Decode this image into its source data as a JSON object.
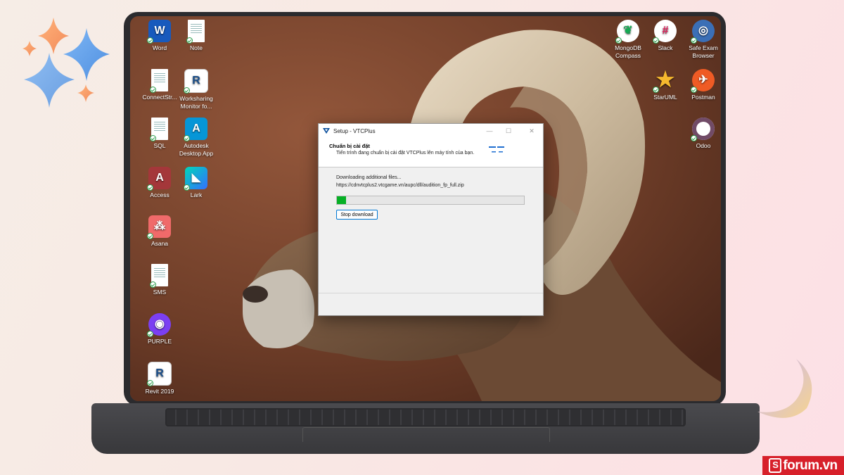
{
  "desktop": {
    "left_icons": [
      {
        "label": "Word",
        "icon": "word-icon",
        "color": "#185abd",
        "glyph": "W"
      },
      {
        "label": "Note",
        "icon": "note-icon",
        "color": "#ffffff",
        "glyph": ""
      },
      {
        "label": "ConnectStr...",
        "icon": "text-file-icon",
        "color": "#ffffff",
        "glyph": ""
      },
      {
        "label": "Worksharing Monitor fo...",
        "icon": "revit-worksharing-icon",
        "color": "#ffffff",
        "glyph": "R"
      },
      {
        "label": "SQL",
        "icon": "text-file-icon",
        "color": "#ffffff",
        "glyph": ""
      },
      {
        "label": "Autodesk Desktop App",
        "icon": "autodesk-icon",
        "color": "#0696d7",
        "glyph": "A"
      },
      {
        "label": "Access",
        "icon": "access-icon",
        "color": "#a4373a",
        "glyph": "A"
      },
      {
        "label": "Lark",
        "icon": "lark-icon",
        "color": "#3370ff",
        "glyph": ""
      },
      {
        "label": "Asana",
        "icon": "asana-icon",
        "color": "#f06a6a",
        "glyph": ""
      },
      {
        "label": "SMS",
        "icon": "text-file-icon",
        "color": "#ffffff",
        "glyph": ""
      },
      {
        "label": "PURPLE",
        "icon": "purple-icon",
        "color": "#7b3ff2",
        "glyph": ""
      },
      {
        "label": "Revit 2019",
        "icon": "revit-icon",
        "color": "#ffffff",
        "glyph": "R"
      }
    ],
    "right_icons": [
      {
        "label": "MongoDB Compass",
        "icon": "mongodb-compass-icon",
        "color": "#ffffff",
        "glyph": ""
      },
      {
        "label": "Slack",
        "icon": "slack-icon",
        "color": "#ffffff",
        "glyph": ""
      },
      {
        "label": "Safe Exam Browser",
        "icon": "safe-exam-browser-icon",
        "color": "#3b6fb6",
        "glyph": ""
      },
      {
        "label": "StarUML",
        "icon": "staruml-icon",
        "color": "transparent",
        "glyph": ""
      },
      {
        "label": "Postman",
        "icon": "postman-icon",
        "color": "#ef5b25",
        "glyph": ""
      },
      {
        "label": "Odoo",
        "icon": "odoo-icon",
        "color": "#714b67",
        "glyph": ""
      }
    ]
  },
  "dialog": {
    "title": "Setup - VTCPlus",
    "heading": "Chuẩn bị cài đặt",
    "subheading": "Tiến trình đang chuẩn bị cài đặt VTCPlus lên máy tính của bạn.",
    "status": "Downloading additional files...",
    "url": "https://cdnvtcplus2.vtcgame.vn/aupc/dll/audition_fp_full.zip",
    "progress": 0.05,
    "stop_label": "Stop download",
    "progress_color": "#06b025"
  },
  "watermark": {
    "text": "forum.vn",
    "prefix": "S"
  }
}
